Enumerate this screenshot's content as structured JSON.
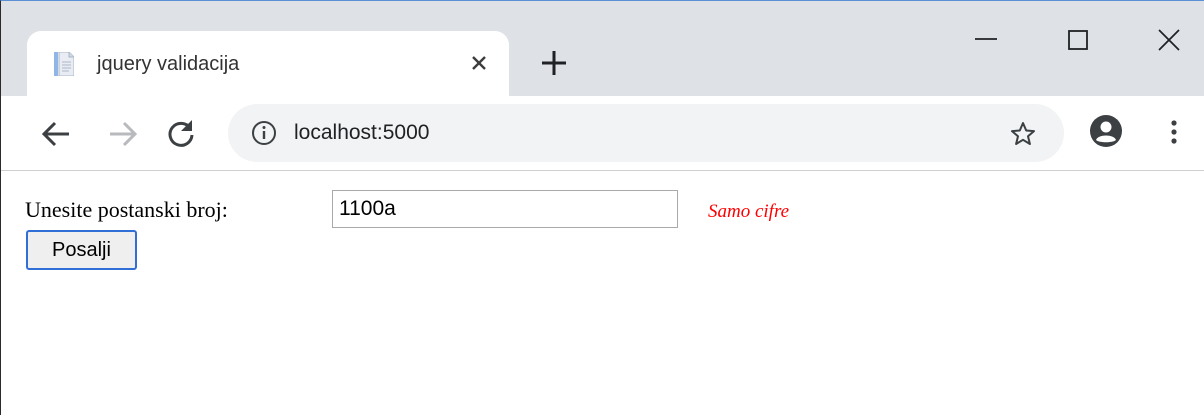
{
  "browser": {
    "tab": {
      "title": "jquery validacija",
      "favicon": "document-icon"
    },
    "address_bar": {
      "url": "localhost:5000"
    }
  },
  "colors": {
    "tabstrip_bg": "#dee1e6",
    "omnibox_bg": "#f1f3f4",
    "error_text": "#ff0000",
    "button_focus_border": "#2f6fd6"
  },
  "page": {
    "form": {
      "postal_label": "Unesite postanski broj:",
      "postal_value": "1100a",
      "error_message": "Samo cifre",
      "submit_label": "Posalji"
    }
  }
}
